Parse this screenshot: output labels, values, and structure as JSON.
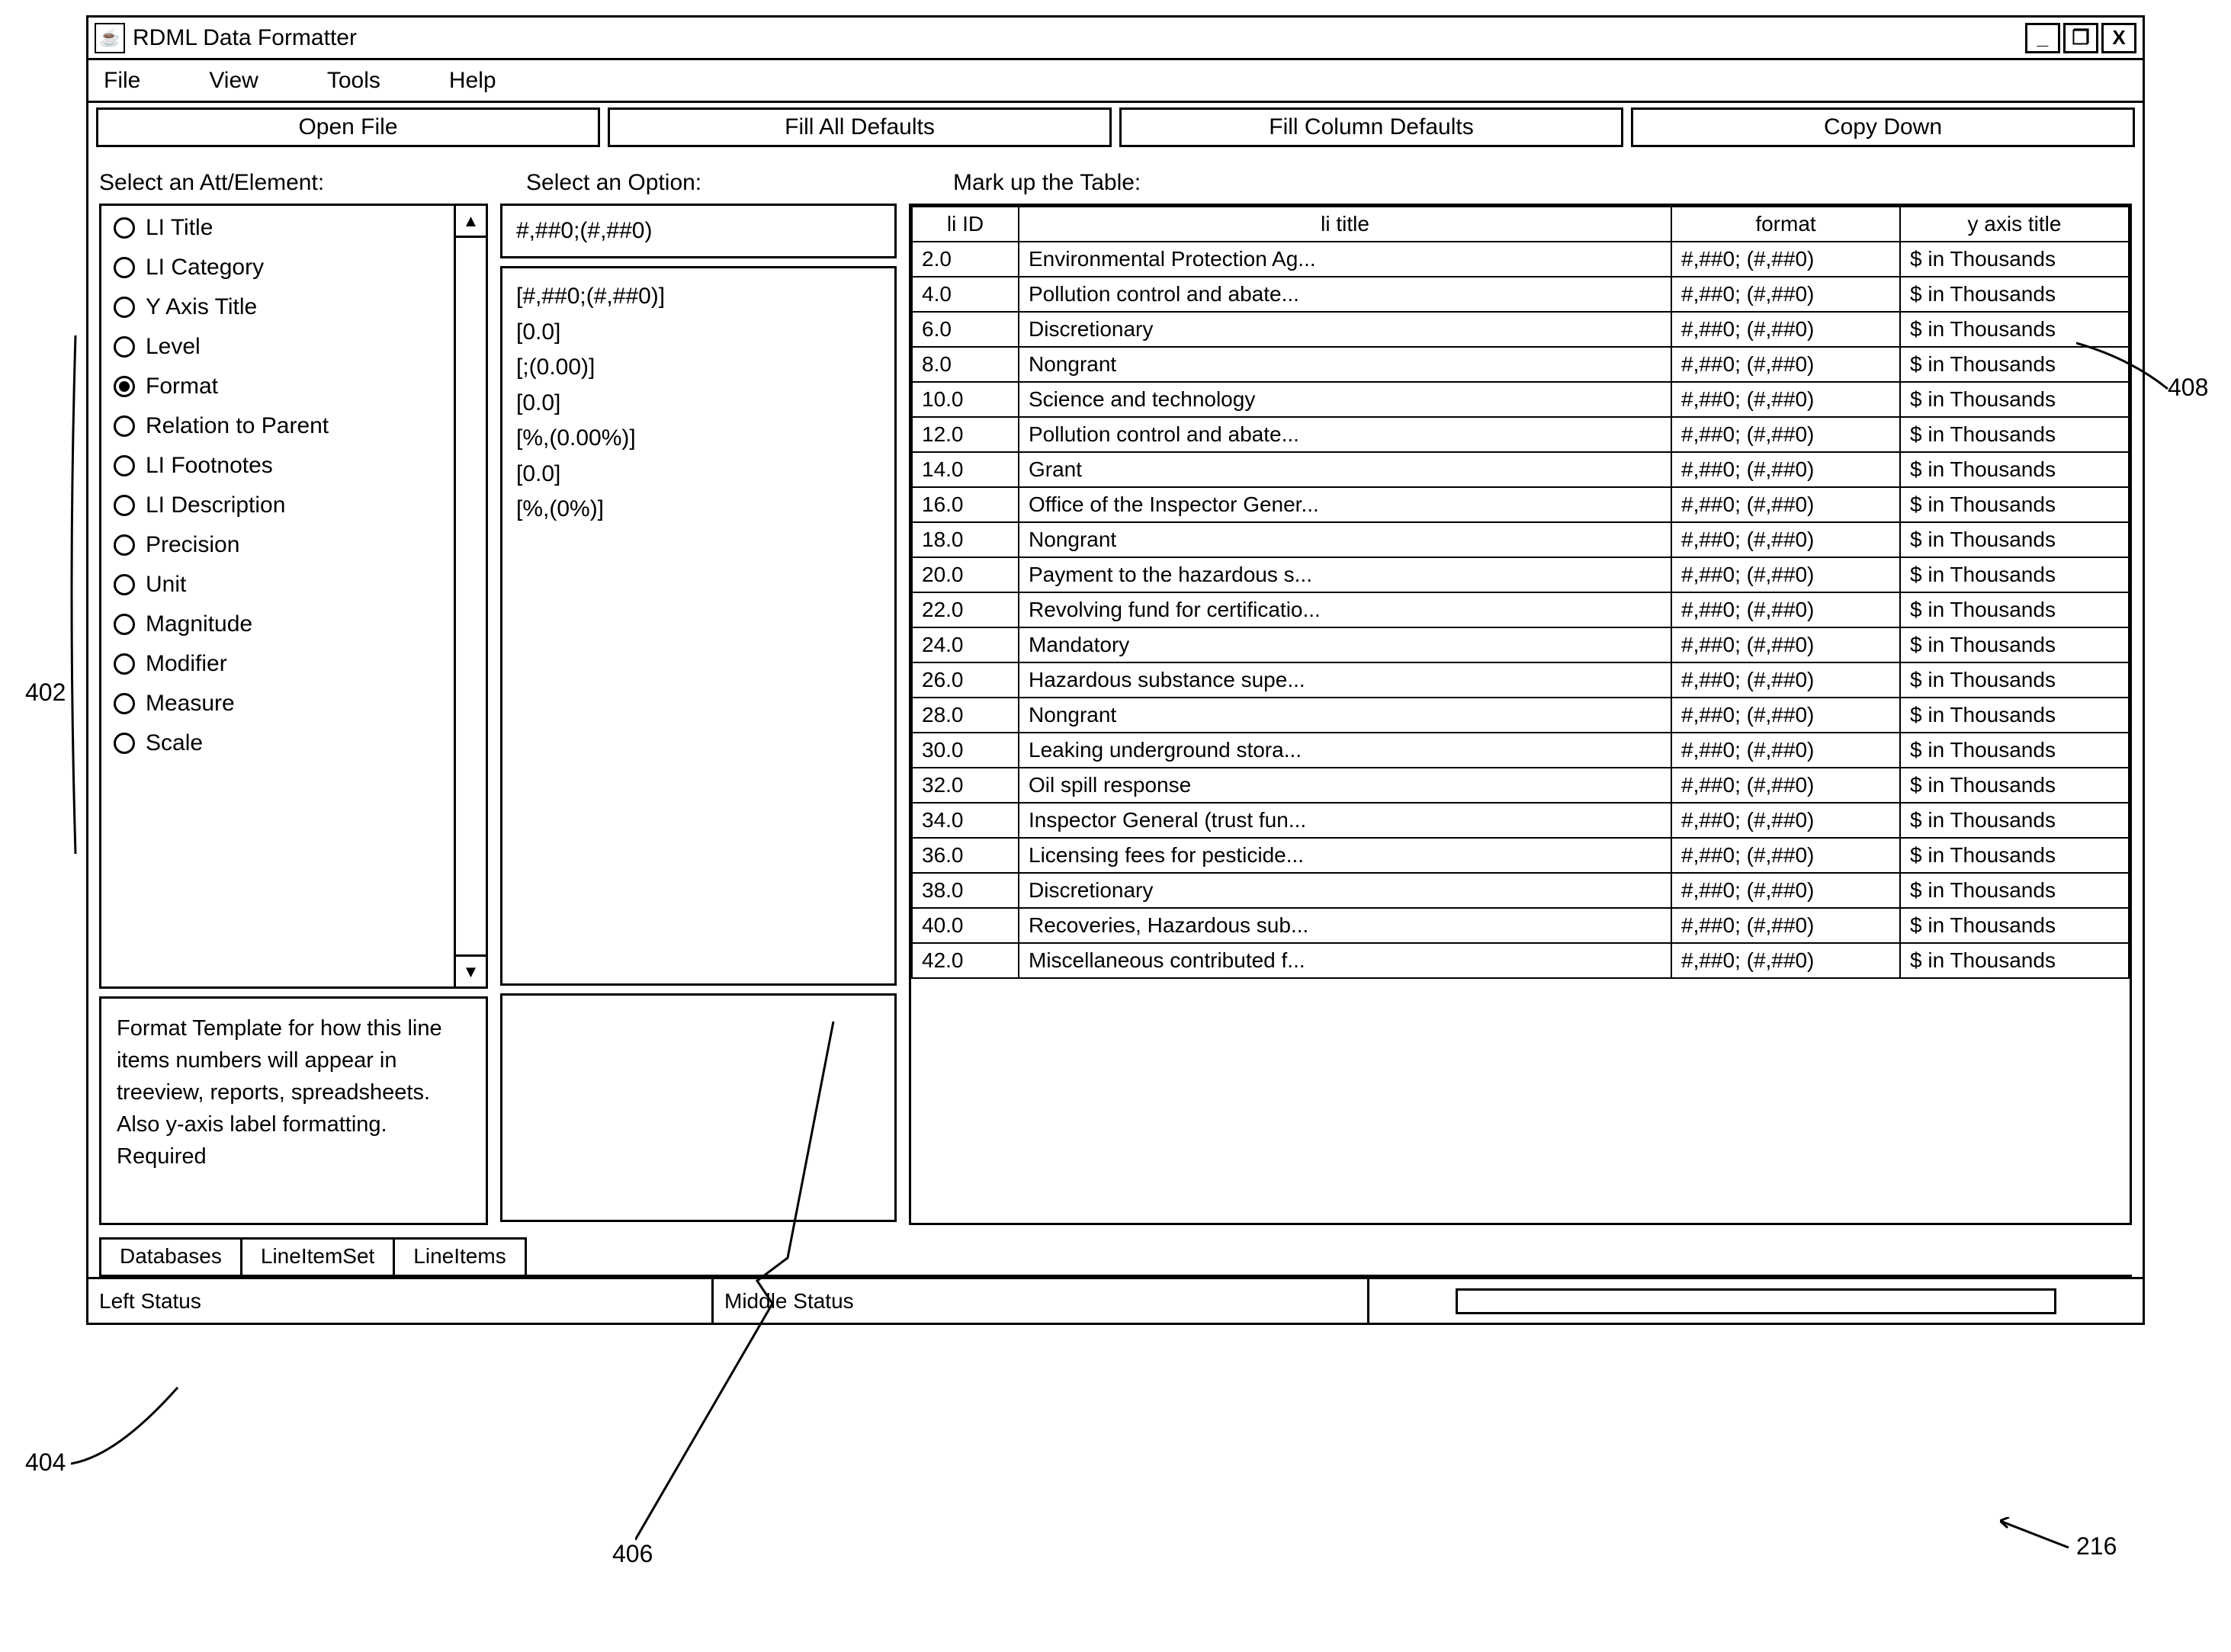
{
  "window": {
    "title": "RDML Data Formatter",
    "icon_glyph": "☕"
  },
  "menubar": [
    "File",
    "View",
    "Tools",
    "Help"
  ],
  "toolbar": [
    "Open File",
    "Fill  All Defaults",
    "Fill Column Defaults",
    "Copy Down"
  ],
  "section_labels": {
    "att": "Select an Att/Element:",
    "option": "Select an Option:",
    "table": "Mark up the Table:"
  },
  "att_list": [
    {
      "label": "LI Title",
      "selected": false
    },
    {
      "label": "LI Category",
      "selected": false
    },
    {
      "label": "Y Axis Title",
      "selected": false
    },
    {
      "label": "Level",
      "selected": false
    },
    {
      "label": "Format",
      "selected": true
    },
    {
      "label": "Relation to Parent",
      "selected": false
    },
    {
      "label": "LI Footnotes",
      "selected": false
    },
    {
      "label": "LI Description",
      "selected": false
    },
    {
      "label": "Precision",
      "selected": false
    },
    {
      "label": "Unit",
      "selected": false
    },
    {
      "label": "Magnitude",
      "selected": false
    },
    {
      "label": "Modifier",
      "selected": false
    },
    {
      "label": "Measure",
      "selected": false
    },
    {
      "label": "Scale",
      "selected": false
    }
  ],
  "description": "Format Template for how this line items numbers will appear in treeview, reports, spreadsheets.  Also y-axis label formatting. Required",
  "option_selected": "#,##0;(#,##0)",
  "option_list": [
    "[#,##0;(#,##0)]",
    "[0.0]",
    "[;(0.00)]",
    "[0.0]",
    "[%,(0.00%)]",
    "[0.0]",
    "[%,(0%)]"
  ],
  "table": {
    "headers": [
      "li ID",
      "li title",
      "format",
      "y axis title"
    ],
    "rows": [
      [
        "2.0",
        "Environmental Protection Ag...",
        "#,##0; (#,##0)",
        "$ in Thousands"
      ],
      [
        "4.0",
        "Pollution control and abate...",
        "#,##0; (#,##0)",
        "$ in Thousands"
      ],
      [
        "6.0",
        "Discretionary",
        "#,##0; (#,##0)",
        "$ in Thousands"
      ],
      [
        "8.0",
        "Nongrant",
        "#,##0; (#,##0)",
        "$ in Thousands"
      ],
      [
        "10.0",
        "Science and technology",
        "#,##0; (#,##0)",
        "$ in Thousands"
      ],
      [
        "12.0",
        "Pollution control and abate...",
        "#,##0; (#,##0)",
        "$ in Thousands"
      ],
      [
        "14.0",
        "Grant",
        "#,##0; (#,##0)",
        "$ in Thousands"
      ],
      [
        "16.0",
        "Office of the Inspector Gener...",
        "#,##0; (#,##0)",
        "$ in Thousands"
      ],
      [
        "18.0",
        "Nongrant",
        "#,##0; (#,##0)",
        "$ in Thousands"
      ],
      [
        "20.0",
        "Payment to the hazardous s...",
        "#,##0; (#,##0)",
        "$ in Thousands"
      ],
      [
        "22.0",
        "Revolving fund for certificatio...",
        "#,##0; (#,##0)",
        "$ in Thousands"
      ],
      [
        "24.0",
        "Mandatory",
        "#,##0; (#,##0)",
        "$ in Thousands"
      ],
      [
        "26.0",
        "Hazardous substance supe...",
        "#,##0; (#,##0)",
        "$ in Thousands"
      ],
      [
        "28.0",
        "Nongrant",
        "#,##0; (#,##0)",
        "$ in Thousands"
      ],
      [
        "30.0",
        "Leaking underground stora...",
        "#,##0; (#,##0)",
        "$ in Thousands"
      ],
      [
        "32.0",
        "Oil spill response",
        "#,##0; (#,##0)",
        "$ in Thousands"
      ],
      [
        "34.0",
        "Inspector General (trust fun...",
        "#,##0; (#,##0)",
        "$ in Thousands"
      ],
      [
        "36.0",
        "Licensing fees for pesticide...",
        "#,##0; (#,##0)",
        "$ in Thousands"
      ],
      [
        "38.0",
        "Discretionary",
        "#,##0; (#,##0)",
        "$ in Thousands"
      ],
      [
        "40.0",
        "Recoveries, Hazardous sub...",
        "#,##0; (#,##0)",
        "$ in Thousands"
      ],
      [
        "42.0",
        "Miscellaneous contributed f...",
        "#,##0; (#,##0)",
        "$ in Thousands"
      ]
    ]
  },
  "tabs": [
    "Databases",
    "LineItemSet",
    "LineItems"
  ],
  "status": {
    "left": "Left Status",
    "middle": "Middle Status"
  },
  "callouts": {
    "a": "402",
    "b": "404",
    "c": "406",
    "d": "408",
    "e": "216"
  }
}
